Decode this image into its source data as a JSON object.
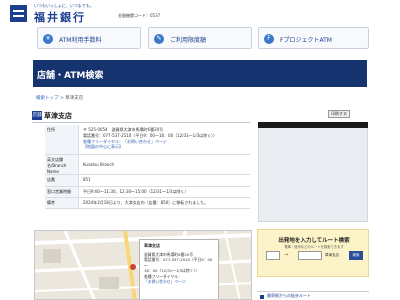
{
  "header": {
    "tagline": "いつもいっしょに、いつまでも。",
    "bank_name": "福井銀行",
    "sub_text": "金融機関コード：0537"
  },
  "nav": [
    {
      "icon": "atm-icon",
      "label": "ATM利用手数料"
    },
    {
      "icon": "edit-icon",
      "label": "ご利用限度額"
    },
    {
      "icon": "f-icon",
      "label": "FプロジェクトATM"
    }
  ],
  "banner": {
    "title": "店舗・ATM検索"
  },
  "breadcrumb": {
    "home": "検索トップ",
    "sep": ">",
    "current": "草津支店"
  },
  "branch": {
    "tag": "店舗",
    "name": "草津支店",
    "print": "印刷する"
  },
  "info": {
    "address_label": "住所",
    "address_lines": [
      "〒 525-0054　滋賀県大津市馬場町6番20号",
      "電話番号：077-537-2510（平日9：00～16：00（12/31～1/3は除く））",
      "各種フリーダイヤル：「お問い合わせ」ページ",
      "【地図の中心に表示】"
    ],
    "english_label_lines": [
      "英文店舗",
      "名/Branch",
      "Name"
    ],
    "english_value": "Kusatsu Branch",
    "code_label": "店番",
    "code_value": "851",
    "hours_label": "窓口営業時間",
    "hours_value": "平日9:00～11:30、12:30～15:00（12/31～1/3は除く）",
    "note_label": "備考",
    "note_value": "2024年3月18日より、大津支店内（店番：850）に移転されました。"
  },
  "map_popup": {
    "title": "草津支店",
    "lines": [
      "滋賀県大津市馬場町6番20号",
      "電話番号：077-537-2510（平日9：00～",
      "16：00（12/31～1/3は除く））",
      "各種フリーダイヤル：",
      "「お問い合わせ」ページ"
    ]
  },
  "route": {
    "title": "出発地を入力してルート検索",
    "sub": "電車・徒歩などのルートを検索できます",
    "arrow": "→",
    "dest": "草津支店",
    "go": "検索"
  },
  "nearby": {
    "label": "最寄駅からの徒歩ルート"
  },
  "colors": {
    "brand": "#1c3f8f",
    "banner": "#15336f",
    "link": "#2a5db0",
    "route_bg": "#fdf3c9"
  }
}
